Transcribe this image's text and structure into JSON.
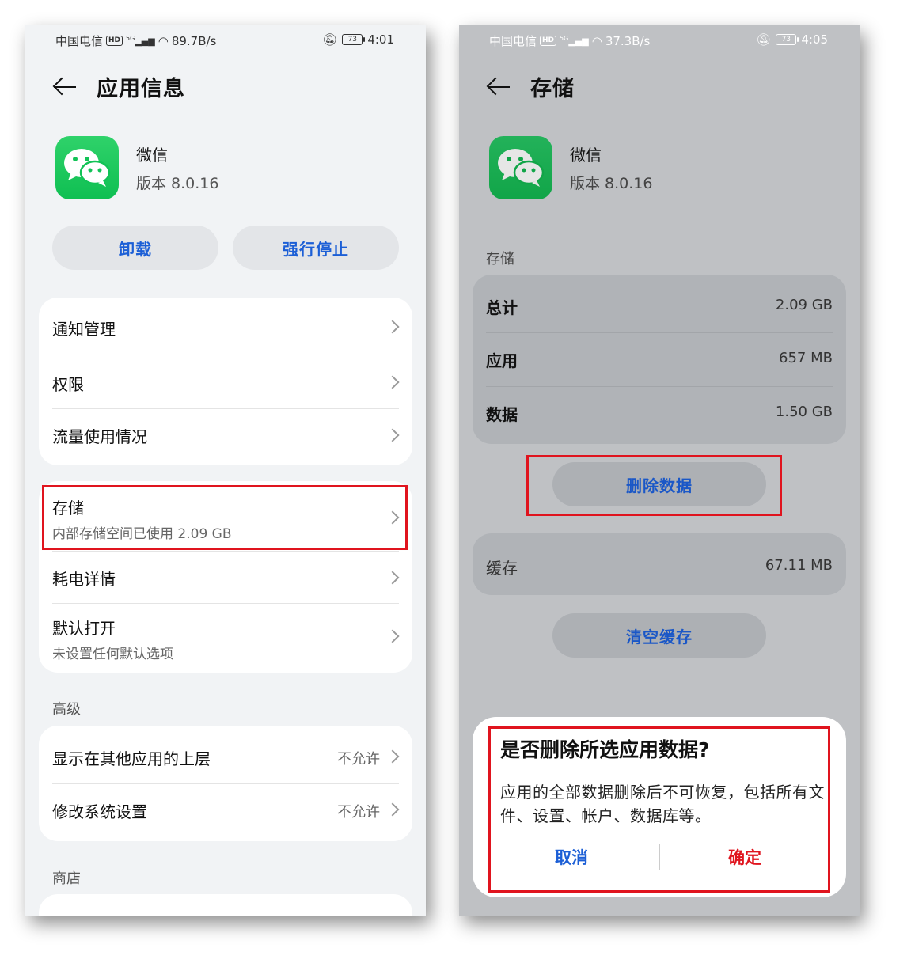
{
  "left": {
    "status": {
      "carrier": "中国电信",
      "hd": "HD",
      "net": "5G",
      "speed": "89.7B/s",
      "battery": "73",
      "time": "4:01"
    },
    "header": {
      "title": "应用信息"
    },
    "app": {
      "name": "微信",
      "version": "版本 8.0.16"
    },
    "buttons": {
      "uninstall": "卸载",
      "force_stop": "强行停止"
    },
    "group1": [
      "通知管理",
      "权限",
      "流量使用情况"
    ],
    "storage": {
      "label": "存储",
      "sub": "内部存储空间已使用 2.09 GB"
    },
    "battery_detail": "耗电详情",
    "default_open": {
      "label": "默认打开",
      "sub": "未设置任何默认选项"
    },
    "advanced": {
      "section": "高级",
      "items": [
        {
          "label": "显示在其他应用的上层",
          "value": "不允许"
        },
        {
          "label": "修改系统设置",
          "value": "不允许"
        }
      ]
    },
    "store_section": "商店"
  },
  "right": {
    "status": {
      "carrier": "中国电信",
      "hd": "HD",
      "net": "5G",
      "speed": "37.3B/s",
      "battery": "73",
      "time": "4:05"
    },
    "header": {
      "title": "存储"
    },
    "app": {
      "name": "微信",
      "version": "版本 8.0.16"
    },
    "storage_section": "存储",
    "storage_rows": [
      {
        "label": "总计",
        "value": "2.09 GB"
      },
      {
        "label": "应用",
        "value": "657 MB"
      },
      {
        "label": "数据",
        "value": "1.50 GB"
      }
    ],
    "delete_data": "删除数据",
    "cache": {
      "label": "缓存",
      "value": "67.11 MB"
    },
    "clear_cache": "清空缓存",
    "dialog": {
      "title": "是否删除所选应用数据?",
      "message": "应用的全部数据删除后不可恢复，包括所有文件、设置、帐户、数据库等。",
      "cancel": "取消",
      "confirm": "确定"
    }
  },
  "colors": {
    "accent": "#1c5fd6",
    "danger": "#e0141e",
    "highlight_box": "#e0141e",
    "wechat_green": "#07c160"
  }
}
